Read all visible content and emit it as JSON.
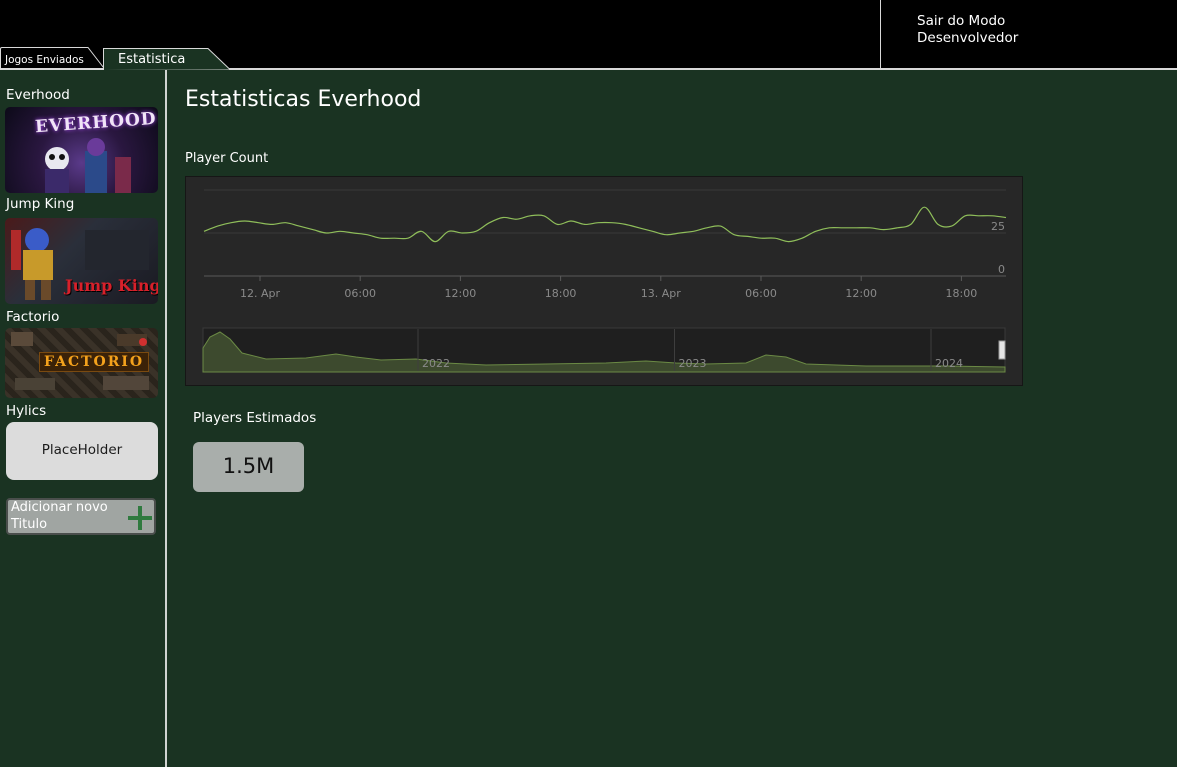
{
  "header": {
    "exit_dev_line1": "Sair do Modo",
    "exit_dev_line2": "Desenvolvedor"
  },
  "tabs": [
    {
      "label": "Jogos Enviados"
    },
    {
      "label": "Estatistica"
    }
  ],
  "sidebar": {
    "games": [
      {
        "title": "Everhood",
        "thumb_caption": "EVERHOOD"
      },
      {
        "title": "Jump King",
        "thumb_caption": "Jump King"
      },
      {
        "title": "Factorio",
        "thumb_caption": "FACTORIO"
      },
      {
        "title": "Hylics",
        "placeholder": "PlaceHolder"
      }
    ],
    "add_button_label": "Adicionar novo Titulo",
    "add_icon": "plus-icon"
  },
  "main": {
    "title": "Estatisticas Everhood",
    "chart_label": "Player Count",
    "players_label": "Players Estimados",
    "players_value": "1.5M"
  },
  "colors": {
    "background": "#1a3322",
    "header": "#000000",
    "chart_background": "#272727",
    "line": "#8fbe5a"
  },
  "chart_data": {
    "type": "line",
    "x_ticks": [
      "12. Apr",
      "06:00",
      "12:00",
      "18:00",
      "13. Apr",
      "06:00",
      "12:00",
      "18:00"
    ],
    "y_ticks": [
      "0",
      "25"
    ],
    "ylim": [
      0,
      50
    ],
    "series": [
      {
        "values": [
          [
            0,
            26
          ],
          [
            1,
            29
          ],
          [
            2,
            31
          ],
          [
            3,
            32
          ],
          [
            4,
            31
          ],
          [
            5,
            30
          ],
          [
            6,
            31
          ],
          [
            7,
            29
          ],
          [
            8,
            27
          ],
          [
            9,
            25
          ],
          [
            10,
            26
          ],
          [
            11,
            25
          ],
          [
            12,
            24
          ],
          [
            13,
            22
          ],
          [
            14,
            22
          ],
          [
            15,
            22
          ],
          [
            16,
            26
          ],
          [
            17,
            20
          ],
          [
            18,
            26
          ],
          [
            19,
            25
          ],
          [
            20,
            26
          ],
          [
            21,
            31
          ],
          [
            22,
            34
          ],
          [
            23,
            33
          ],
          [
            24,
            35
          ],
          [
            25,
            35
          ],
          [
            26,
            30
          ],
          [
            27,
            32
          ],
          [
            28,
            30
          ],
          [
            29,
            31
          ],
          [
            30,
            31
          ],
          [
            31,
            30
          ],
          [
            32,
            28
          ],
          [
            33,
            26
          ],
          [
            34,
            24
          ],
          [
            35,
            25
          ],
          [
            36,
            26
          ],
          [
            37,
            28
          ],
          [
            38,
            29
          ],
          [
            39,
            24
          ],
          [
            40,
            23
          ],
          [
            41,
            22
          ],
          [
            42,
            22
          ],
          [
            43,
            20
          ],
          [
            44,
            22
          ],
          [
            45,
            26
          ],
          [
            46,
            28
          ],
          [
            47,
            28
          ],
          [
            48,
            28
          ],
          [
            49,
            28
          ],
          [
            50,
            27
          ],
          [
            51,
            28
          ],
          [
            52,
            30
          ],
          [
            53,
            40
          ],
          [
            54,
            30
          ],
          [
            55,
            29
          ],
          [
            56,
            35
          ],
          [
            57,
            35
          ],
          [
            58,
            35
          ],
          [
            59,
            34
          ]
        ]
      }
    ],
    "navigator": {
      "x_ticks": [
        "2022",
        "2023",
        "2024"
      ]
    },
    "grid": true
  }
}
